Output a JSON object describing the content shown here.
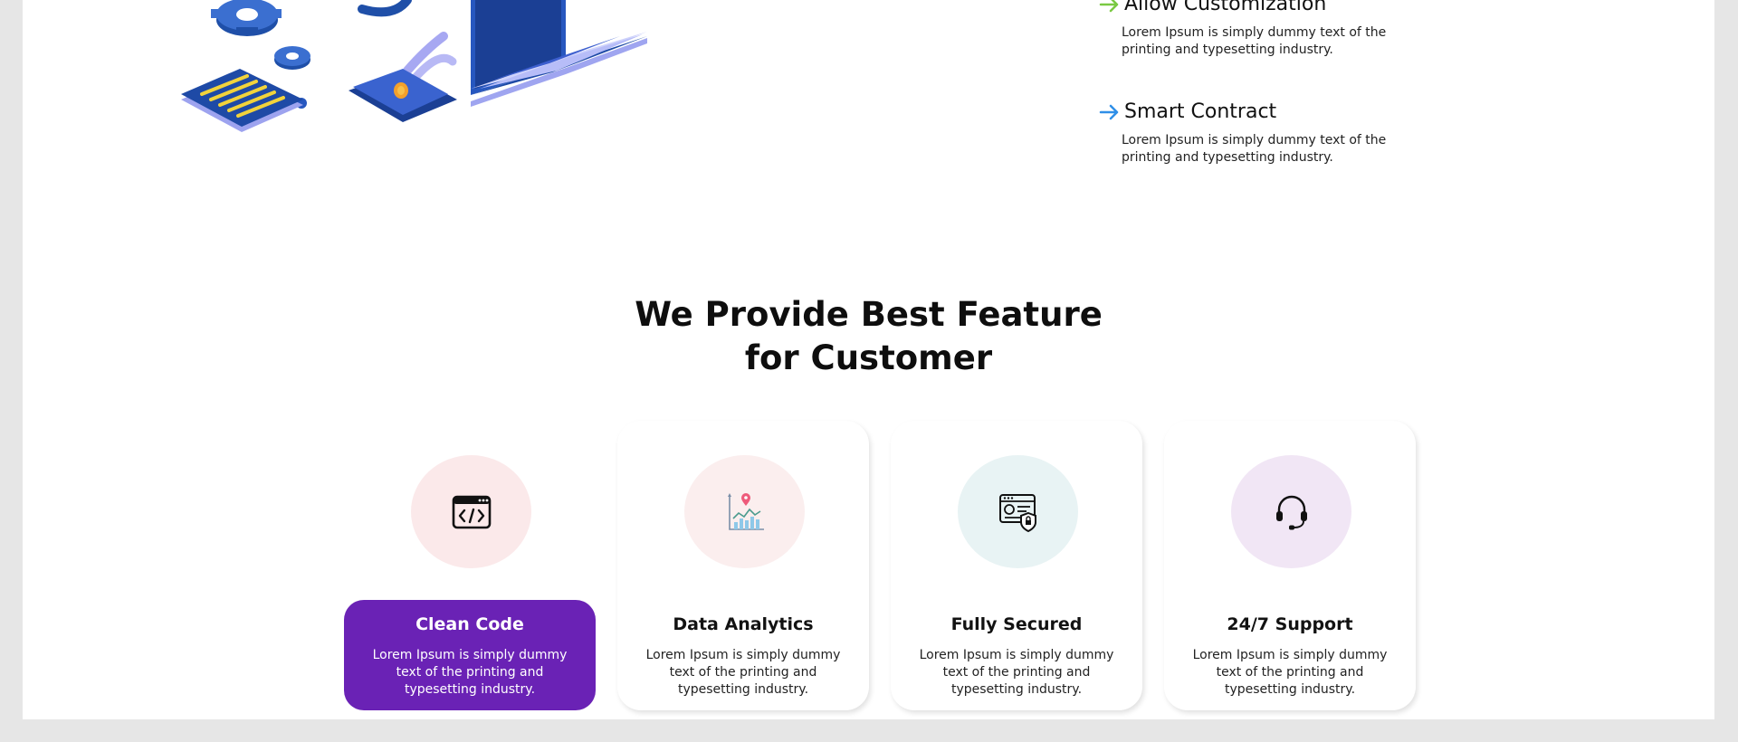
{
  "colors": {
    "accent": "#6a22b5",
    "arrow_green": "#7ac943",
    "arrow_blue": "#2f8fe8",
    "circle_pink": "#fbe9ea",
    "circle_peach": "#fbeeee",
    "circle_teal": "#e8f3f4",
    "circle_lavender": "#f1e6f5"
  },
  "features_top": [
    {
      "title": "Allow Customization",
      "icon": "arrow-right-green-icon",
      "desc": "Lorem Ipsum is simply dummy text of the printing and typesetting industry."
    },
    {
      "title": "Smart Contract",
      "icon": "arrow-right-blue-icon",
      "desc": "Lorem Ipsum is simply dummy text of the printing and typesetting industry."
    }
  ],
  "section": {
    "title_line1": "We Provide Best Feature",
    "title_line2": "for Customer"
  },
  "cards": [
    {
      "title": "Clean Code",
      "icon": "code-window-icon",
      "desc": "Lorem Ipsum is simply dummy text of the printing and typesetting industry.",
      "active": true
    },
    {
      "title": "Data Analytics",
      "icon": "analytics-chart-icon",
      "desc": "Lorem Ipsum is simply dummy text of the printing and typesetting industry.",
      "active": false
    },
    {
      "title": "Fully Secured",
      "icon": "secure-profile-icon",
      "desc": "Lorem Ipsum is simply dummy text of the printing and typesetting industry.",
      "active": false
    },
    {
      "title": "24/7 Support",
      "icon": "headset-icon",
      "desc": "Lorem Ipsum is simply dummy text of the printing and typesetting industry.",
      "active": false
    }
  ]
}
